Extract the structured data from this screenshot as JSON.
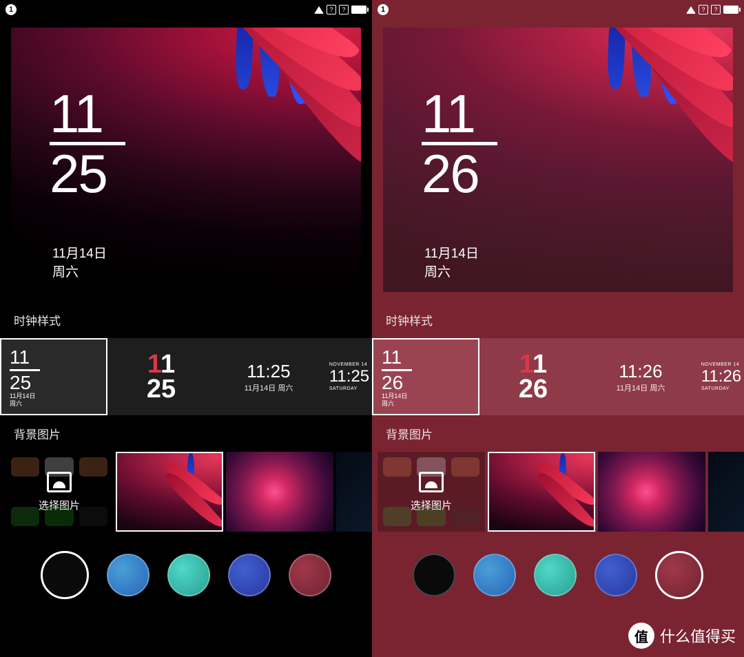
{
  "status": {
    "badge": "1"
  },
  "left": {
    "clock": {
      "hour": "11",
      "minute": "25",
      "date": "11月14日",
      "day": "周六"
    },
    "sections": {
      "clock_style": "时钟样式",
      "background": "背景图片"
    },
    "styles": {
      "s1": {
        "h": "11",
        "m": "25",
        "date": "11月14日",
        "day": "周六"
      },
      "s2": {
        "h1": "1",
        "h2": "1",
        "m": "25"
      },
      "s3": {
        "time": "11:25",
        "date": "11月14日 周六"
      },
      "s4": {
        "d": "NOVEMBER 14",
        "t": "11:25",
        "s": "SATURDAY"
      }
    },
    "pick": "选择图片"
  },
  "right": {
    "clock": {
      "hour": "11",
      "minute": "26",
      "date": "11月14日",
      "day": "周六"
    },
    "sections": {
      "clock_style": "时钟样式",
      "background": "背景图片"
    },
    "styles": {
      "s1": {
        "h": "11",
        "m": "26",
        "date": "11月14日",
        "day": "周六"
      },
      "s2": {
        "h1": "1",
        "h2": "1",
        "m": "26"
      },
      "s3": {
        "time": "11:26",
        "date": "11月14日 周六"
      },
      "s4": {
        "d": "NOVEMBER 14",
        "t": "11:26",
        "s": "SATURDAY"
      }
    },
    "pick": "选择图片"
  },
  "colors": {
    "black": "#0a0a0a",
    "blue1": "#2865b8",
    "teal": "#2a9f90",
    "blue2": "#2838a0",
    "red": "#7A2432"
  },
  "watermark": {
    "char": "值",
    "text": "什么值得买"
  }
}
